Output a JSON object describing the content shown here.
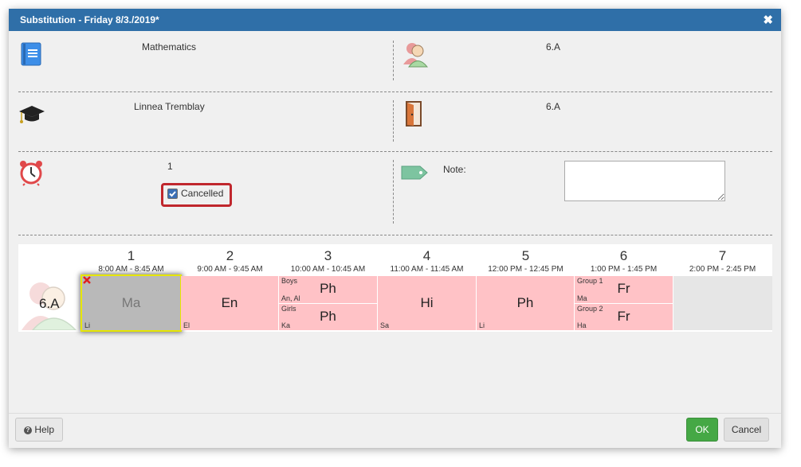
{
  "dialog": {
    "title": "Substitution - Friday 8/3./2019*",
    "close_glyph": "✖"
  },
  "fields": {
    "subject": "Mathematics",
    "class": "6.A",
    "teacher": "Linnea Tremblay",
    "room": "6.A",
    "period": "1",
    "cancelled_label": "Cancelled",
    "cancelled_checked": true,
    "note_label": "Note:",
    "note_value": ""
  },
  "icons": {
    "subject": "book-icon",
    "class": "students-icon",
    "teacher": "graduation-cap-icon",
    "room": "door-icon",
    "period": "alarm-clock-icon",
    "note": "tag-icon"
  },
  "timetable": {
    "row_label": "6.A",
    "periods": [
      {
        "num": "1",
        "time": "8:00 AM - 8:45 AM"
      },
      {
        "num": "2",
        "time": "9:00 AM - 9:45 AM"
      },
      {
        "num": "3",
        "time": "10:00 AM - 10:45 AM"
      },
      {
        "num": "4",
        "time": "11:00 AM - 11:45 AM"
      },
      {
        "num": "5",
        "time": "12:00 PM - 12:45 PM"
      },
      {
        "num": "6",
        "time": "1:00 PM - 1:45 PM"
      },
      {
        "num": "7",
        "time": "2:00 PM - 2:45 PM"
      }
    ],
    "lessons": [
      {
        "subject": "Ma",
        "teacher": "Li",
        "cancelled": true
      },
      {
        "subject": "En",
        "teacher": "El"
      },
      {
        "groups": [
          {
            "group": "Boys",
            "subject": "Ph",
            "teacher": "An, Al"
          },
          {
            "group": "Girls",
            "subject": "Ph",
            "teacher": "Ka"
          }
        ]
      },
      {
        "subject": "Hi",
        "teacher": "Sa"
      },
      {
        "subject": "Ph",
        "teacher": "Li"
      },
      {
        "groups": [
          {
            "group": "Group 1",
            "subject": "Fr",
            "teacher": "Ma"
          },
          {
            "group": "Group 2",
            "subject": "Fr",
            "teacher": "Ha"
          }
        ]
      }
    ]
  },
  "footer": {
    "help_label": "Help",
    "ok_label": "OK",
    "cancel_label": "Cancel"
  },
  "colors": {
    "titlebar": "#2f6fa8",
    "lesson": "#ffc2c6",
    "cancelled_lesson": "#b9b9b9",
    "selected_border": "#e6e600",
    "highlight": "#c0272d",
    "ok": "#45a845"
  }
}
